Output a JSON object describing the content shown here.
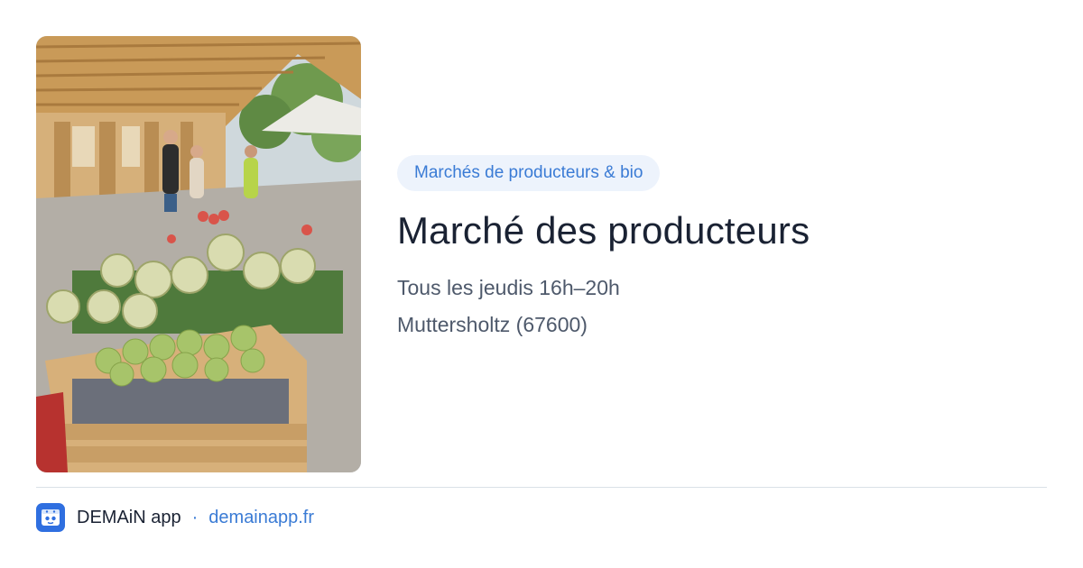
{
  "card": {
    "photo_alt": "Marché des producteurs",
    "category_badge": "Marchés de producteurs & bio",
    "title": "Marché des producteurs",
    "schedule": "Tous les jeudis 16h–20h",
    "location": "Muttersholtz (67600)"
  },
  "footer": {
    "app_name": "DEMAiN app",
    "separator": "·",
    "site": "demainapp.fr",
    "icon": "app-logo-icon"
  },
  "colors": {
    "accent": "#3a7bd5",
    "badge_bg": "#edf3fc",
    "title": "#1a2233",
    "subtext": "#4e596b",
    "divider": "#d9e1e7"
  }
}
